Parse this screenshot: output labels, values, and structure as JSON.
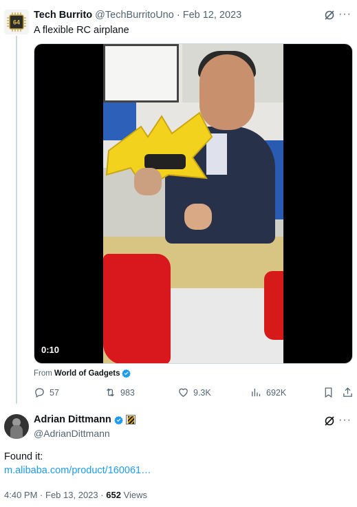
{
  "tweet1": {
    "avatar_text": "64",
    "name": "Tech Burrito",
    "handle": "@TechBurritoUno",
    "separator": "·",
    "date": "Feb 12, 2023",
    "text": "A flexible RC airplane",
    "video": {
      "duration": "0:10"
    },
    "from_label": "From",
    "from_account": "World of Gadgets",
    "stats": {
      "replies": "57",
      "retweets": "983",
      "likes": "9.3K",
      "views": "692K"
    }
  },
  "tweet2": {
    "name": "Adrian Dittmann",
    "handle": "@AdrianDittmann",
    "text": "Found it:",
    "link": "m.alibaba.com/product/160061…",
    "time": "4:40 PM",
    "separator": "·",
    "date": "Feb 13, 2023",
    "separator2": "·",
    "views_count": "652",
    "views_label": "Views"
  },
  "colors": {
    "accent": "#1d9bf0",
    "muted": "#536471",
    "text": "#0f1419",
    "verified": "#1d9bf0"
  },
  "icons": [
    "chip-avatar-icon",
    "grok-icon",
    "more-icon",
    "verified-icon",
    "reply-icon",
    "retweet-icon",
    "like-icon",
    "views-icon",
    "bookmark-icon",
    "share-icon"
  ]
}
